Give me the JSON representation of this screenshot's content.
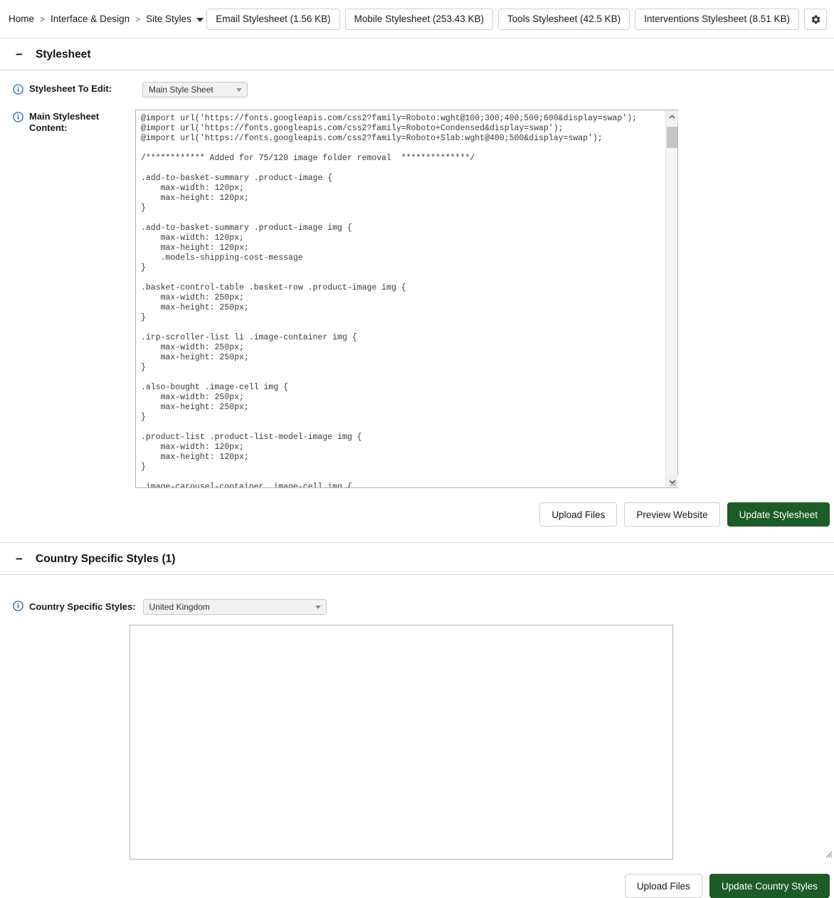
{
  "breadcrumb": {
    "items": [
      "Home",
      "Interface & Design",
      "Site Styles"
    ],
    "separator": ">"
  },
  "topbar": {
    "buttons": [
      "Email Stylesheet (1.56 KB)",
      "Mobile Stylesheet (253.43 KB)",
      "Tools Stylesheet (42.5 KB)",
      "Interventions Stylesheet (8.51 KB)"
    ],
    "settings_icon": "gear-icon"
  },
  "colors": {
    "primary_button": "#1d5c26",
    "info_icon": "#1b5faa",
    "border": "#cfcfcf"
  },
  "stylesheet_section": {
    "collapse_glyph": "−",
    "title": "Stylesheet",
    "stylesheet_to_edit": {
      "label": "Stylesheet To Edit:",
      "selected": "Main Style Sheet",
      "options": [
        "Main Style Sheet"
      ]
    },
    "content_field": {
      "label_line1": "Main Stylesheet",
      "label_line2": "Content:",
      "value": "@import url('https://fonts.googleapis.com/css2?family=Roboto:wght@100;300;400;500;600&display=swap');\n@import url('https://fonts.googleapis.com/css2?family=Roboto+Condensed&display=swap');\n@import url('https://fonts.googleapis.com/css2?family=Roboto+Slab:wght@400;500&display=swap');\n\n/************ Added for 75/120 image folder removal  **************/\n\n.add-to-basket-summary .product-image {\n    max-width: 120px;\n    max-height: 120px;\n}\n\n.add-to-basket-summary .product-image img {\n    max-width: 120px;\n    max-height: 120px;\n    .models-shipping-cost-message\n}\n\n.basket-control-table .basket-row .product-image img {\n    max-width: 250px;\n    max-height: 250px;\n}\n\n.irp-scroller-list li .image-container img {\n    max-width: 250px;\n    max-height: 250px;\n}\n\n.also-bought .image-cell img {\n    max-width: 250px;\n    max-height: 250px;\n}\n\n.product-list .product-list-model-image img {\n    max-width: 120px;\n    max-height: 120px;\n}\n\n.image-carousel-container .image-cell img {"
    },
    "buttons": {
      "upload": "Upload Files",
      "preview": "Preview Website",
      "update": "Update Stylesheet"
    }
  },
  "country_section": {
    "collapse_glyph": "−",
    "title": "Country Specific Styles (1)",
    "country_field": {
      "label": "Country Specific Styles:",
      "selected": "United Kingdom",
      "options": [
        "United Kingdom"
      ]
    },
    "content_value": "",
    "buttons": {
      "upload": "Upload Files",
      "update": "Update Country Styles"
    }
  }
}
